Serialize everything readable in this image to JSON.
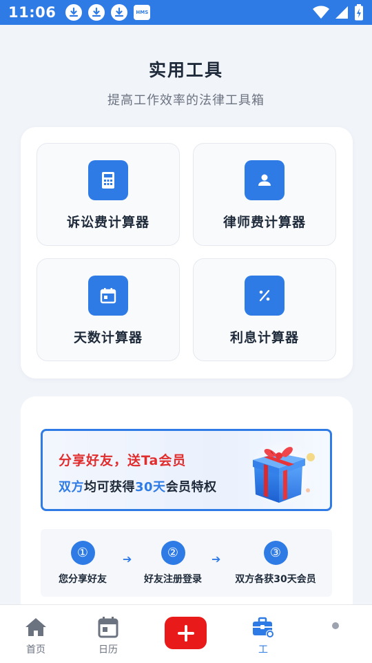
{
  "status_bar": {
    "time": "11:06",
    "notification_icons": [
      "download-icon",
      "download-icon",
      "download-icon",
      "hms-icon"
    ],
    "hms_label": "HMS",
    "system_icons": [
      "wifi-icon",
      "signal-icon",
      "battery-charging-icon"
    ]
  },
  "header": {
    "title": "实用工具",
    "subtitle": "提高工作效率的法律工具箱"
  },
  "tools": [
    {
      "label": "诉讼费计算器",
      "icon": "calculator-icon"
    },
    {
      "label": "律师费计算器",
      "icon": "person-icon"
    },
    {
      "label": "天数计算器",
      "icon": "calendar-icon"
    },
    {
      "label": "利息计算器",
      "icon": "percent-icon"
    }
  ],
  "share": {
    "banner_title": "分享好友，送Ta会员",
    "banner_line_prefix": "双方",
    "banner_line_mid": "均可获得",
    "banner_line_days": "30天",
    "banner_line_suffix": "会员特权",
    "steps": [
      {
        "number": "①",
        "label": "您分享好友"
      },
      {
        "number": "②",
        "label": "好友注册登录"
      },
      {
        "number": "③",
        "label": "双方各获30天会员"
      }
    ]
  },
  "tab_bar": {
    "items": [
      {
        "label": "首页",
        "icon": "home-icon"
      },
      {
        "label": "日历",
        "icon": "calendar-icon"
      },
      {
        "label": "",
        "icon": "add-icon"
      },
      {
        "label": "工",
        "icon": "toolbox-icon",
        "active": true
      },
      {
        "label": "",
        "icon": "profile-icon"
      }
    ]
  },
  "colors": {
    "accent": "#2f7be5",
    "add_button": "#e81a1a",
    "promo_red": "#e02d2d",
    "background": "#f1f4f9"
  }
}
